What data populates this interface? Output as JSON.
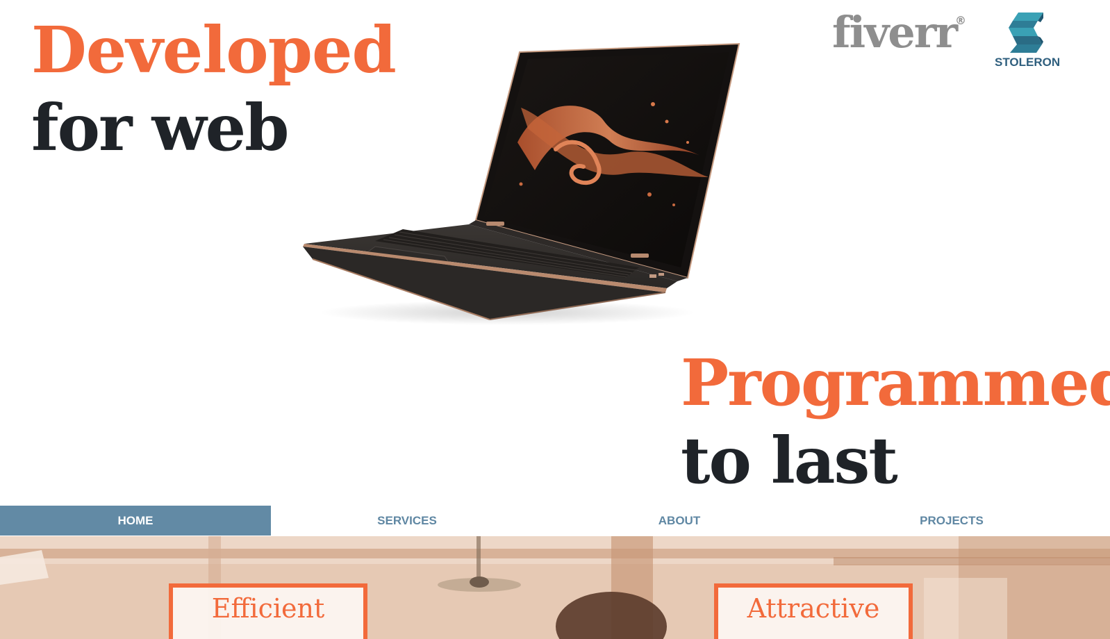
{
  "hero": {
    "left_headline": {
      "accent": "Developed",
      "dark": "for web"
    },
    "right_headline": {
      "accent": "Programmed",
      "dark": "to last"
    },
    "logos": {
      "fiverr": "fiverr",
      "fiverr_registered": "®",
      "stoleron": "STOLERON"
    }
  },
  "nav": {
    "items": [
      {
        "label": "HOME",
        "active": true
      },
      {
        "label": "SERVICES",
        "active": false
      },
      {
        "label": "ABOUT",
        "active": false
      },
      {
        "label": "PROJECTS",
        "active": false
      }
    ]
  },
  "features": {
    "cards": [
      {
        "title": "Efficient"
      },
      {
        "title": "Attractive"
      }
    ]
  },
  "colors": {
    "accent": "#f26a3b",
    "dark_text": "#1f2328",
    "nav_active_bg": "#628aa5",
    "nav_text": "#5f87a3",
    "logo_gray": "#8e8e8e",
    "stoleron_blue": "#2f5f7e"
  },
  "icons": {
    "laptop": "laptop-image",
    "stoleron_mark": "stoleron-s-icon"
  }
}
